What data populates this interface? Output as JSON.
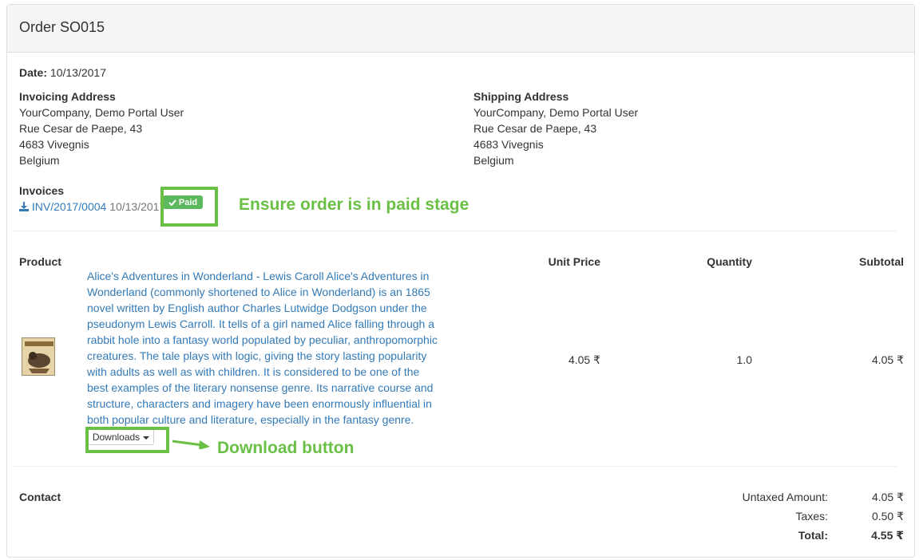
{
  "order": {
    "title": "Order SO015",
    "date_label": "Date:",
    "date_value": "10/13/2017"
  },
  "invoicing": {
    "heading": "Invoicing Address",
    "lines": [
      "YourCompany, Demo Portal User",
      "Rue Cesar de Paepe, 43",
      "4683 Vivegnis",
      "Belgium"
    ]
  },
  "shipping": {
    "heading": "Shipping Address",
    "lines": [
      "YourCompany, Demo Portal User",
      "Rue Cesar de Paepe, 43",
      "4683 Vivegnis",
      "Belgium"
    ]
  },
  "invoices": {
    "heading": "Invoices",
    "number": "INV/2017/0004",
    "date": "10/13/2017",
    "status": "Paid"
  },
  "table": {
    "headers": {
      "product": "Product",
      "unit_price": "Unit Price",
      "quantity": "Quantity",
      "subtotal": "Subtotal"
    },
    "rows": [
      {
        "description": "Alice's Adventures in Wonderland - Lewis Caroll Alice's Adventures in Wonderland (commonly shortened to Alice in Wonderland) is an 1865 novel written by English author Charles Lutwidge Dodgson under the pseudonym Lewis Carroll. It tells of a girl named Alice falling through a rabbit hole into a fantasy world populated by peculiar, anthropomorphic creatures. The tale plays with logic, giving the story lasting popularity with adults as well as with children. It is considered to be one of the best examples of the literary nonsense genre. Its narrative course and structure, characters and imagery have been enormously influential in both popular culture and literature, especially in the fantasy genre.",
        "unit_price": "4.05 ₹",
        "quantity": "1.0",
        "subtotal": "4.05 ₹",
        "downloads_label": "Downloads"
      }
    ]
  },
  "contact": {
    "heading": "Contact"
  },
  "totals": {
    "untaxed_label": "Untaxed Amount:",
    "untaxed_value": "4.05 ₹",
    "taxes_label": "Taxes:",
    "taxes_value": "0.50 ₹",
    "total_label": "Total:",
    "total_value": "4.55 ₹"
  },
  "annotations": {
    "paid_note": "Ensure order is in paid stage",
    "download_note": "Download button",
    "highlight_color": "#6abf45"
  },
  "colors": {
    "link": "#337ab7",
    "badge_success": "#5cb85c",
    "header_bg": "#f5f5f5"
  },
  "icons": {
    "download": "download-icon",
    "check": "check-icon",
    "caret": "caret-down-icon",
    "arrow": "arrow-right-icon"
  }
}
